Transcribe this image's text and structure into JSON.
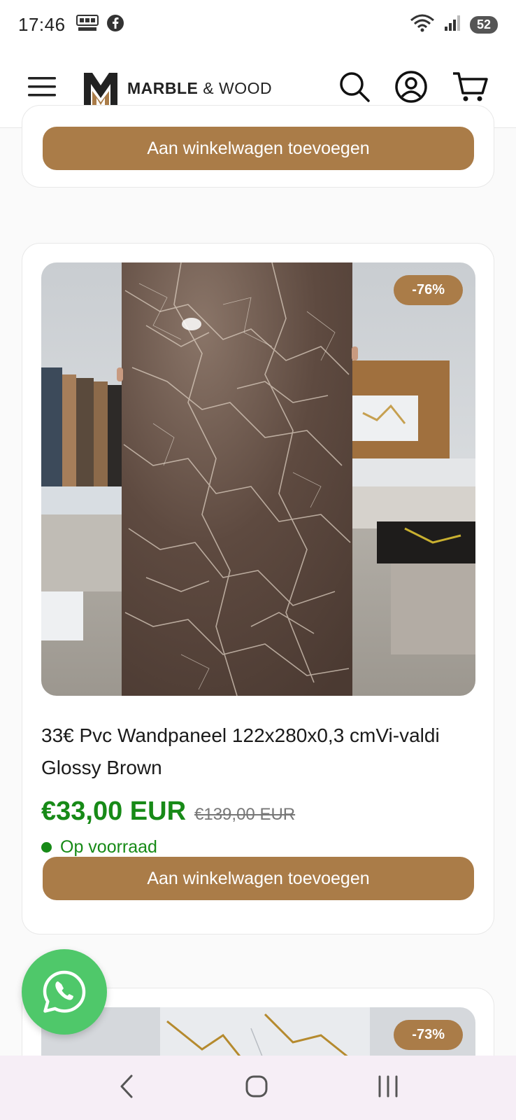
{
  "status_bar": {
    "time": "17:46",
    "battery": "52",
    "icons": [
      "notification-blast-icon",
      "facebook-icon",
      "wifi-icon",
      "signal-icon"
    ]
  },
  "header": {
    "brand_bold": "MARBLE",
    "brand_rest": "& WOOD",
    "icons": [
      "menu-icon",
      "search-icon",
      "account-icon",
      "cart-icon"
    ]
  },
  "products": {
    "prev_card": {
      "cart_button": "Aan winkelwagen toevoegen"
    },
    "main_card": {
      "badge": "-76%",
      "title": "33€ Pvc Wandpaneel 122x280x0,3 cmVi-valdi Glossy Brown",
      "price": "€33,00 EUR",
      "old_price": "€139,00 EUR",
      "stock": "Op voorraad",
      "cart_button": "Aan winkelwagen toevoegen"
    },
    "next_card": {
      "badge": "-73%"
    }
  },
  "colors": {
    "accent": "#aa7c48",
    "price_green": "#178a17",
    "whatsapp_green": "#4fc86a"
  },
  "navbar": {
    "icons": [
      "back-icon",
      "home-icon",
      "recents-icon"
    ]
  }
}
